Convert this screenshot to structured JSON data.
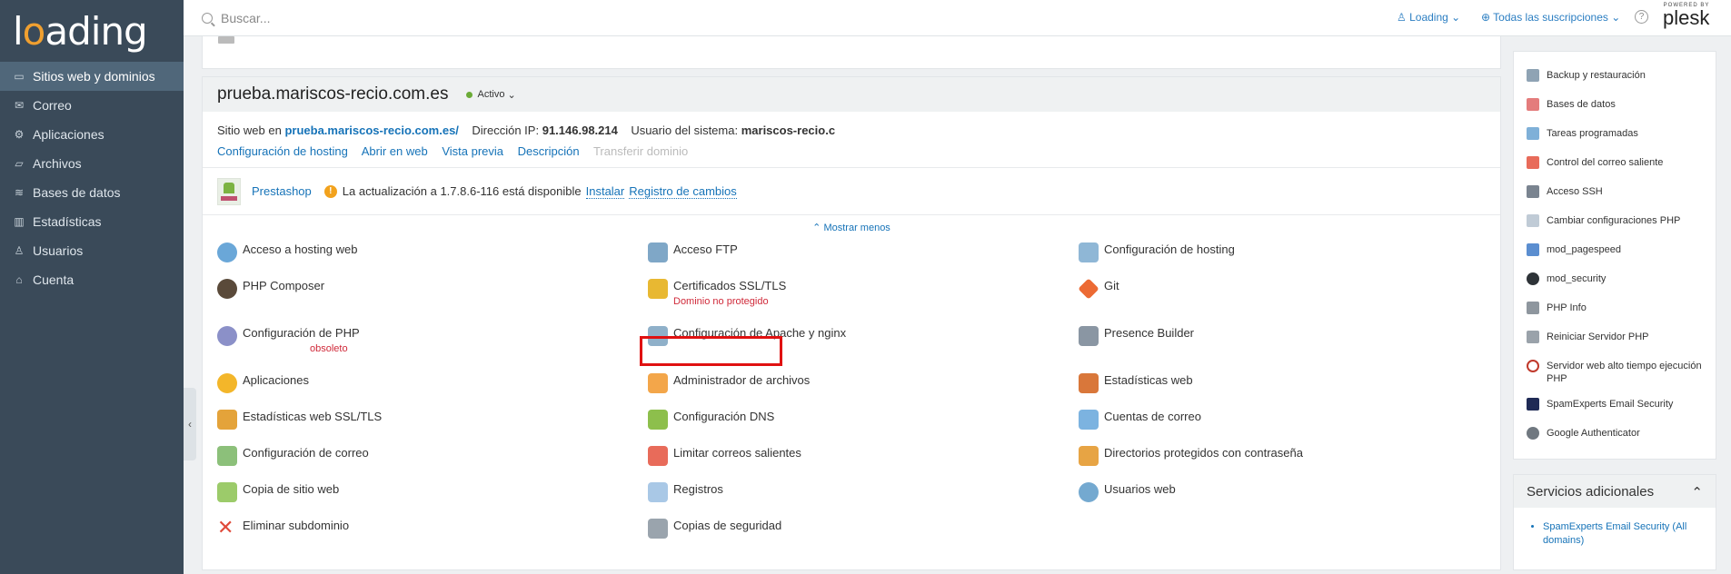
{
  "sidebar": {
    "logo": "loading",
    "items": [
      {
        "label": "Sitios web y dominios",
        "icon": "monitor-icon",
        "active": true
      },
      {
        "label": "Correo",
        "icon": "envelope-icon"
      },
      {
        "label": "Aplicaciones",
        "icon": "gear-icon"
      },
      {
        "label": "Archivos",
        "icon": "folder-icon"
      },
      {
        "label": "Bases de datos",
        "icon": "database-icon"
      },
      {
        "label": "Estadísticas",
        "icon": "bar-chart-icon"
      },
      {
        "label": "Usuarios",
        "icon": "user-icon"
      },
      {
        "label": "Cuenta",
        "icon": "account-icon"
      }
    ]
  },
  "topbar": {
    "search_placeholder": "Buscar...",
    "user": "Loading",
    "subscriptions": "Todas las suscripciones",
    "help": "?",
    "powered_by": "POWERED BY",
    "brand": "plesk"
  },
  "domain": {
    "name": "prueba.mariscos-recio.com.es",
    "status": "Activo",
    "website_prefix": "Sitio web en",
    "website_link": "prueba.mariscos-recio.com.es/",
    "ip_label": "Dirección IP:",
    "ip": "91.146.98.214",
    "sysuser_label": "Usuario del sistema:",
    "sysuser": "mariscos-recio.c",
    "links": [
      "Configuración de hosting",
      "Abrir en web",
      "Vista previa",
      "Descripción"
    ],
    "disabled_link": "Transferir dominio"
  },
  "app": {
    "name": "Prestashop",
    "message": "La actualización a 1.7.8.6-116 está disponible",
    "install": "Instalar",
    "changelog": "Registro de cambios"
  },
  "show_less": "Mostrar menos",
  "grid": {
    "col1": [
      "Acceso a hosting web",
      "PHP Composer",
      "Configuración de PHP",
      "Aplicaciones",
      "Estadísticas web SSL/TLS",
      "Configuración de correo",
      "Copia de sitio web",
      "Eliminar subdominio"
    ],
    "col2": [
      "Acceso FTP",
      "Certificados SSL/TLS",
      "Configuración de Apache y nginx",
      "Administrador de archivos",
      "Configuración DNS",
      "Limitar correos salientes",
      "Registros",
      "Copias de seguridad"
    ],
    "col3": [
      "Configuración de hosting",
      "Git",
      "Presence Builder",
      "Estadísticas web",
      "Cuentas de correo",
      "Directorios protegidos con contraseña",
      "Usuarios web"
    ],
    "php_note": "obsoleto",
    "ssl_note": "Dominio no protegido"
  },
  "tools": [
    "Backup y restauración",
    "Bases de datos",
    "Tareas programadas",
    "Control del correo saliente",
    "Acceso SSH",
    "Cambiar configuraciones PHP",
    "mod_pagespeed",
    "mod_security",
    "PHP Info",
    "Reiniciar Servidor PHP",
    "Servidor web alto tiempo ejecución PHP",
    "SpamExperts Email Security",
    "Google Authenticator"
  ],
  "extra": {
    "title": "Servicios adicionales",
    "items": [
      "SpamExperts Email Security (All domains)"
    ]
  },
  "colors": {
    "accent": "#1673b8",
    "sidebar": "#3a4a59",
    "highlight": "#e01111",
    "status_ok": "#6bab37",
    "error": "#d02a3a"
  }
}
